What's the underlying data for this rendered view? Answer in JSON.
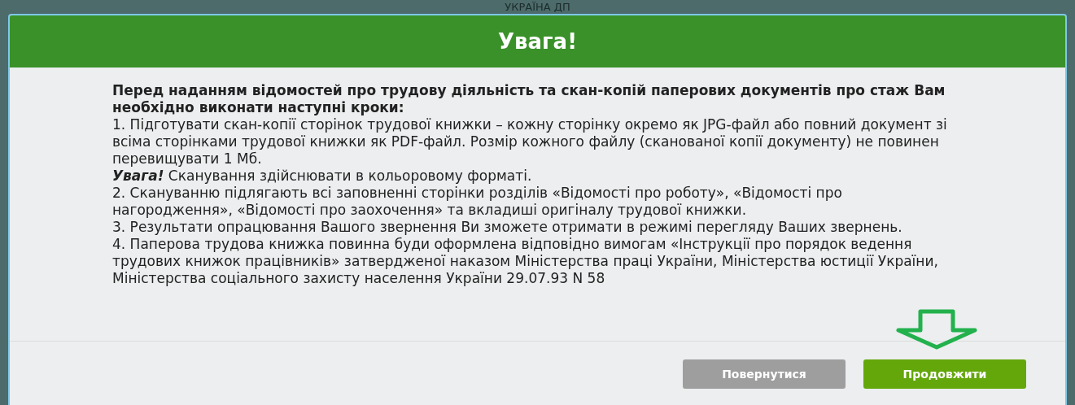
{
  "background": {
    "title": "УКРАЇНА ДП"
  },
  "dialog": {
    "title": "Увага!",
    "intro": "Перед наданням відомостей про трудову діяльність та скан-копій паперових документів про стаж Вам необхідно виконати наступні кроки:",
    "steps": [
      {
        "text": "1. Підготувати скан-копії сторінок трудової книжки – кожну сторінку окремо як JPG-файл або повний документ зі всіма сторінками трудової книжки як PDF-файл. Розмір кожного файлу (сканованої копії документу) не повинен перевищувати 1 Мб.",
        "note": {
          "label": "Увага!",
          "text": "Сканування здійснювати в кольоровому форматі."
        }
      },
      {
        "text": "2. Скануванню підлягають всі заповненні сторінки розділів «Відомості про роботу», «Відомості про нагородження», «Відомості про заохочення» та вкладиші оригіналу трудової книжки."
      },
      {
        "text": "3. Результати опрацювання Вашого звернення Ви зможете отримати в режимі перегляду Ваших звернень."
      },
      {
        "text": "4. Паперова трудова книжка повинна буди оформлена відповідно вимогам «Інструкції про порядок ведення трудових книжок працівників» затвердженої наказом Міністерства праці України, Міністерства юстиції України, Міністерства соціального захисту населення України 29.07.93 N 58"
      }
    ],
    "buttons": [
      {
        "label": "Повернутися",
        "kind": "secondary"
      },
      {
        "label": "Продовжити",
        "kind": "primary"
      }
    ]
  }
}
